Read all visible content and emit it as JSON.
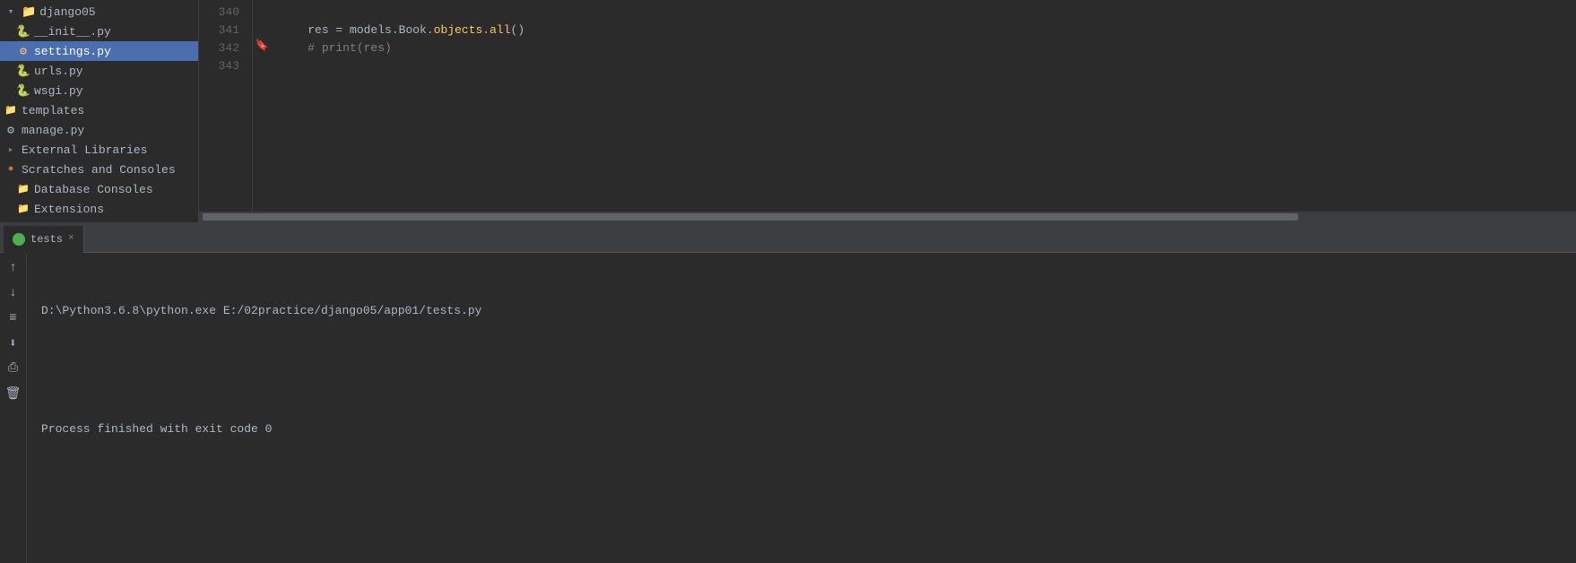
{
  "sidebar": {
    "items": [
      {
        "id": "django05-folder",
        "label": "django05",
        "indent": 0,
        "type": "folder",
        "selected": false
      },
      {
        "id": "init-py",
        "label": "__init__.py",
        "indent": 1,
        "type": "py",
        "selected": false
      },
      {
        "id": "settings-py",
        "label": "settings.py",
        "indent": 1,
        "type": "settings",
        "selected": true
      },
      {
        "id": "urls-py",
        "label": "urls.py",
        "indent": 1,
        "type": "py",
        "selected": false
      },
      {
        "id": "wsgi-py",
        "label": "wsgi.py",
        "indent": 1,
        "type": "py",
        "selected": false
      },
      {
        "id": "templates-folder",
        "label": "templates",
        "indent": 0,
        "type": "folder",
        "selected": false
      },
      {
        "id": "manage-py",
        "label": "manage.py",
        "indent": 0,
        "type": "manage",
        "selected": false
      },
      {
        "id": "external-libraries",
        "label": "External Libraries",
        "indent": 0,
        "type": "ext",
        "selected": false
      },
      {
        "id": "scratches-consoles",
        "label": "Scratches and Consoles",
        "indent": 0,
        "type": "scratch",
        "selected": false
      },
      {
        "id": "database-consoles",
        "label": "Database Consoles",
        "indent": 1,
        "type": "db",
        "selected": false
      },
      {
        "id": "extensions",
        "label": "Extensions",
        "indent": 1,
        "type": "folder",
        "selected": false
      }
    ]
  },
  "editor": {
    "lines": [
      {
        "number": "340",
        "content": ""
      },
      {
        "number": "341",
        "content": "    res = models.Book.objects.all()"
      },
      {
        "number": "342",
        "content": "    # print(res)"
      },
      {
        "number": "343",
        "content": ""
      }
    ]
  },
  "run_panel": {
    "tab_label": "tests",
    "close_label": "×",
    "terminal_lines": [
      "D:\\Python3.6.8\\python.exe E:/02practice/django05/app01/tests.py",
      "",
      "Process finished with exit code 0"
    ]
  },
  "toolbar_buttons": [
    {
      "id": "up-btn",
      "icon": "↑"
    },
    {
      "id": "down-btn",
      "icon": "↓"
    },
    {
      "id": "wrap-btn",
      "icon": "≡"
    },
    {
      "id": "save-btn",
      "icon": "⬇"
    },
    {
      "id": "print-btn",
      "icon": "⎙"
    },
    {
      "id": "clear-btn",
      "icon": "🗑"
    }
  ],
  "colors": {
    "accent": "#4b6eaf",
    "selected_bg": "#4b6eaf",
    "bg": "#2b2b2b",
    "panel_bg": "#3c3f41",
    "tab_green": "#4CAF50"
  }
}
